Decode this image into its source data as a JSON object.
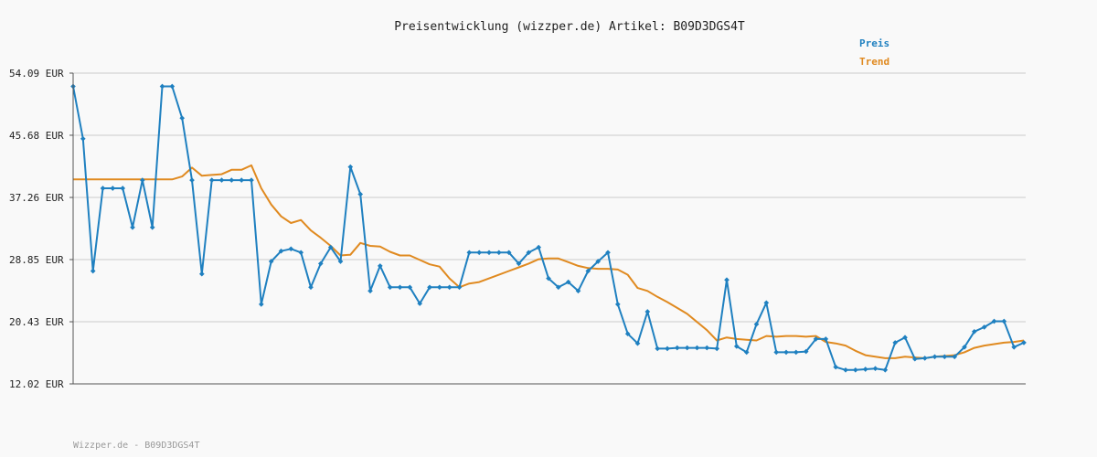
{
  "chart_data": {
    "type": "line",
    "title": "Preisentwicklung (wizzper.de) Artikel: B09D3DGS4T",
    "footer": "Wizzper.de - B09D3DGS4T",
    "unit": "EUR",
    "ylim": [
      12.02,
      54.09
    ],
    "yticks": [
      "54.09 EUR",
      "45.68 EUR",
      "37.26 EUR",
      "28.85 EUR",
      "20.43 EUR",
      "12.02 EUR"
    ],
    "ytick_values": [
      54.09,
      45.68,
      37.26,
      28.85,
      20.43,
      12.02
    ],
    "grid": true,
    "legend_position": "top-right",
    "series": [
      {
        "name": "Preis",
        "color": "#1f80c0",
        "values": [
          52.3,
          45.2,
          27.3,
          38.5,
          38.5,
          38.5,
          33.2,
          39.6,
          33.2,
          52.3,
          52.3,
          48.0,
          39.6,
          26.9,
          39.6,
          39.6,
          39.6,
          39.6,
          39.6,
          22.8,
          28.6,
          30.0,
          30.3,
          29.8,
          25.1,
          28.3,
          30.5,
          28.6,
          41.4,
          37.7,
          24.6,
          28.0,
          25.1,
          25.1,
          25.1,
          22.9,
          25.1,
          25.1,
          25.1,
          25.1,
          29.8,
          29.8,
          29.8,
          29.8,
          29.8,
          28.3,
          29.8,
          30.5,
          26.3,
          25.1,
          25.8,
          24.6,
          27.3,
          28.6,
          29.8,
          22.8,
          18.8,
          17.5,
          21.8,
          16.8,
          16.8,
          16.9,
          16.9,
          16.9,
          16.9,
          16.8,
          26.1,
          17.1,
          16.3,
          20.1,
          23.0,
          16.3,
          16.3,
          16.3,
          16.4,
          18.1,
          18.1,
          14.3,
          13.9,
          13.9,
          14.0,
          14.1,
          13.9,
          17.6,
          18.3,
          15.4,
          15.5,
          15.7,
          15.7,
          15.7,
          17.0,
          19.1,
          19.7,
          20.5,
          20.5,
          17.0,
          17.6
        ]
      },
      {
        "name": "Trend",
        "color": "#e08a20",
        "values": [
          39.7,
          39.7,
          39.7,
          39.7,
          39.7,
          39.7,
          39.7,
          39.7,
          39.7,
          39.7,
          39.7,
          40.1,
          41.3,
          40.2,
          40.3,
          40.4,
          41.0,
          41.0,
          41.6,
          38.5,
          36.3,
          34.7,
          33.8,
          34.2,
          32.8,
          31.8,
          30.7,
          29.4,
          29.5,
          31.1,
          30.7,
          30.6,
          29.9,
          29.4,
          29.4,
          28.8,
          28.2,
          27.9,
          26.3,
          25.1,
          25.6,
          25.8,
          26.3,
          26.8,
          27.3,
          27.8,
          28.3,
          28.9,
          29.0,
          29.0,
          28.5,
          28.0,
          27.7,
          27.6,
          27.6,
          27.5,
          26.8,
          25.0,
          24.6,
          23.8,
          23.1,
          22.3,
          21.5,
          20.4,
          19.3,
          17.9,
          18.3,
          18.1,
          18.0,
          17.9,
          18.5,
          18.4,
          18.5,
          18.5,
          18.4,
          18.5,
          17.7,
          17.5,
          17.2,
          16.5,
          15.9,
          15.7,
          15.5,
          15.5,
          15.7,
          15.6,
          15.5,
          15.7,
          15.8,
          15.9,
          16.3,
          16.9,
          17.2,
          17.4,
          17.6,
          17.7,
          17.9
        ]
      }
    ]
  }
}
